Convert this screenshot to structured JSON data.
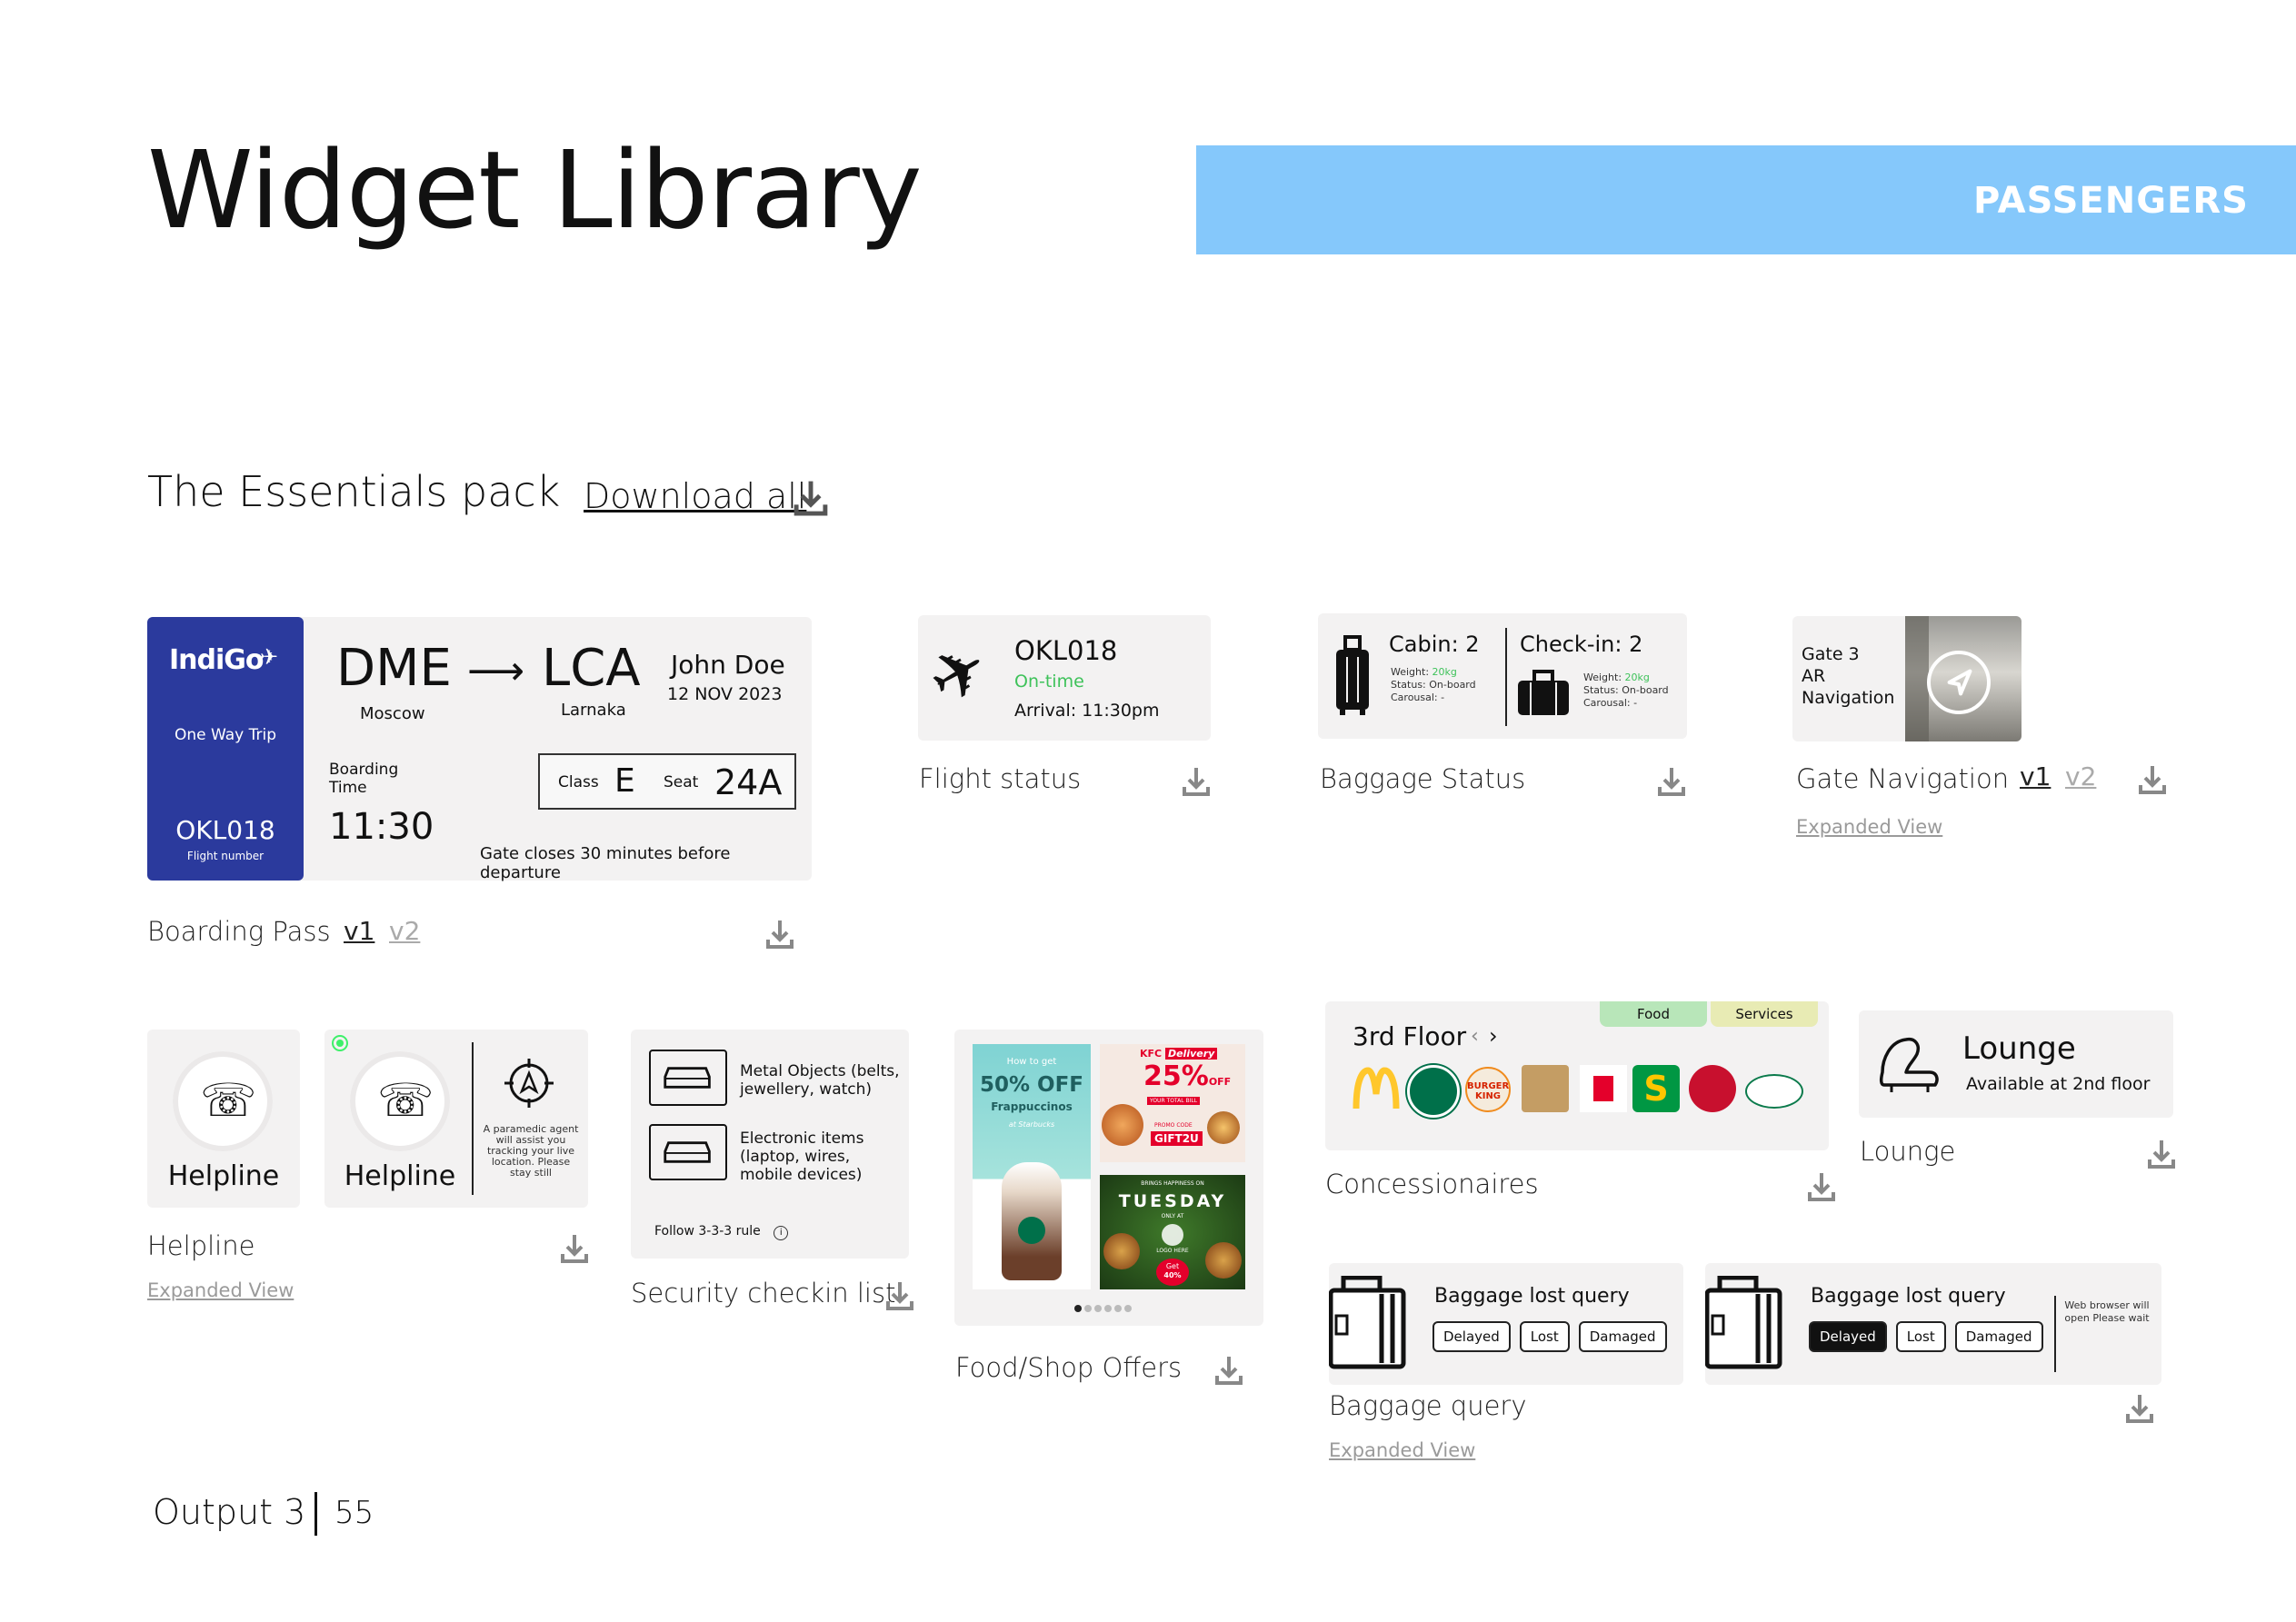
{
  "header": {
    "title": "Widget Library",
    "tag": "PASSENGERS",
    "tag_color": "#85c8fb"
  },
  "section": {
    "title": "The Essentials pack",
    "download_all": "Download all"
  },
  "boarding_pass": {
    "airline": "IndiGo",
    "trip": "One Way Trip",
    "flight": "OKL018",
    "flight_caption": "Flight number",
    "from_code": "DME",
    "from_city": "Moscow",
    "to_code": "LCA",
    "to_city": "Larnaka",
    "passenger": "John Doe",
    "date": "12 NOV 2023",
    "boarding_label": "Boarding Time",
    "boarding_time": "11:30",
    "class_label": "Class",
    "class_value": "E",
    "seat_label": "Seat",
    "seat_value": "24A",
    "gate_note": "Gate closes 30 minutes before departure",
    "accent": "#2b3a9d",
    "caption": "Boarding Pass",
    "v1": "v1",
    "v2": "v2"
  },
  "flight_status": {
    "flight": "OKL018",
    "status": "On-time",
    "arrival": "Arrival: 11:30pm",
    "status_color": "#3ec25a",
    "caption": "Flight status"
  },
  "baggage_status": {
    "cabin": "Cabin: 2",
    "checkin": "Check-in: 2",
    "weight_label": "Weight:",
    "weight_value": "20kg",
    "status_line": "Status: On-board",
    "carousel": "Carousal: -",
    "caption": "Baggage Status"
  },
  "gate_nav": {
    "line1": "Gate 3",
    "line2": "AR",
    "line3": "Navigation",
    "caption": "Gate Navigation",
    "v1": "v1",
    "v2": "v2",
    "expanded": "Expanded View"
  },
  "helpline": {
    "label": "Helpline",
    "label2": "Helpline",
    "assist": "A paramedic agent will assist you tracking your live location. Please stay still",
    "caption": "Helpline",
    "expanded": "Expanded View"
  },
  "security": {
    "item1": "Metal Objects (belts, jewellery, watch)",
    "item2": "Electronic items (laptop, wires, mobile devices)",
    "rule": "Follow 3-3-3 rule",
    "caption": "Security checkin list"
  },
  "offers": {
    "starbucks_line1": "How to get",
    "starbucks_off": "50% OFF",
    "starbucks_product": "Frappuccinos",
    "starbucks_at": "at Starbucks",
    "kfc_brand": "KFC",
    "kfc_tag": "Delivery",
    "kfc_off": "25%",
    "kfc_off_suffix": "OFF",
    "kfc_line": "YOUR TOTAL BILL",
    "kfc_promo": "PROMO CODE",
    "kfc_code": "GIFT2U",
    "tue_line": "BRINGS HAPPINESS ON",
    "tue_day": "TUESDAY",
    "tue_only": "ONLY AT",
    "tue_logo": "LOGO HERE",
    "tue_get": "Get",
    "tue_off": "40%",
    "caption": "Food/Shop Offers"
  },
  "concessionaires": {
    "floor": "3rd Floor",
    "tab_food": "Food",
    "tab_services": "Services",
    "caption": "Concessionaires",
    "brands": [
      "mcdonalds-logo",
      "starbucks-logo",
      "burger-king-logo",
      "nishan-logo",
      "kfc-logo",
      "subway-logo",
      "pizza-hut-logo",
      "krispy-kreme-logo"
    ]
  },
  "lounge": {
    "title": "Lounge",
    "sub": "Available at 2nd floor",
    "caption": "Lounge"
  },
  "baggage_query": {
    "title": "Baggage lost query",
    "title2": "Baggage lost query",
    "opt1": "Delayed",
    "opt2": "Lost",
    "opt3": "Damaged",
    "web": "Web browser will open Please wait",
    "caption": "Baggage query",
    "expanded": "Expanded View"
  },
  "footer": {
    "output": "Output 3",
    "page": "55"
  }
}
